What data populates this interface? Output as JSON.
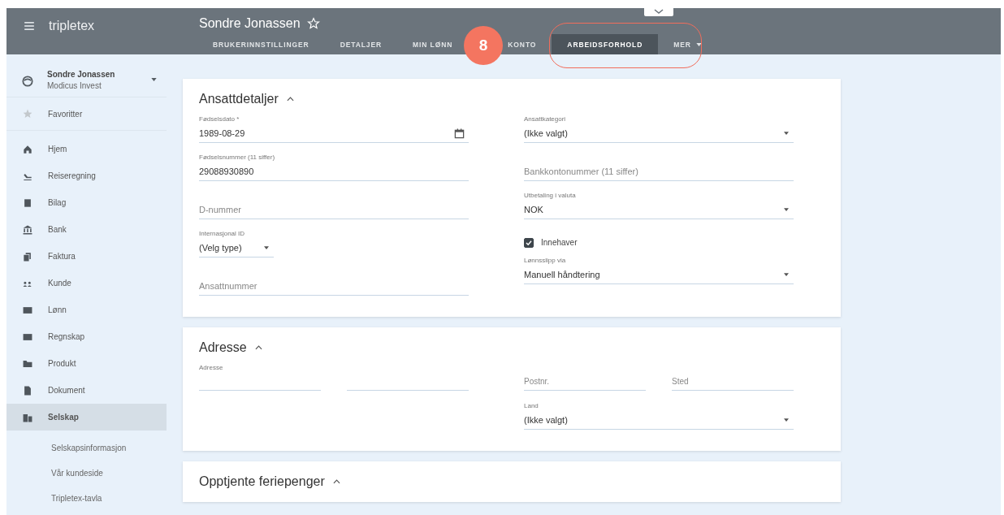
{
  "header": {
    "logo": "tripletex",
    "title": "Sondre Jonassen",
    "favorite": false,
    "tabs": [
      {
        "label": "BRUKERINNSTILLINGER",
        "selected": false
      },
      {
        "label": "DETALJER",
        "selected": false
      },
      {
        "label": "MIN LØNN",
        "selected": false
      },
      {
        "label": "KONTO",
        "selected": false
      },
      {
        "label": "ARBEIDSFORHOLD",
        "selected": true
      },
      {
        "label": "MER",
        "selected": false
      }
    ]
  },
  "callout": {
    "number": "8"
  },
  "sidebar": {
    "user": {
      "name": "Sondre Jonassen",
      "company": "Modicus Invest"
    },
    "favorites": "Favoritter",
    "items": [
      {
        "label": "Hjem",
        "selected": false
      },
      {
        "label": "Reiseregning",
        "selected": false
      },
      {
        "label": "Bilag",
        "selected": false
      },
      {
        "label": "Bank",
        "selected": false
      },
      {
        "label": "Faktura",
        "selected": false
      },
      {
        "label": "Kunde",
        "selected": false
      },
      {
        "label": "Lønn",
        "selected": false
      },
      {
        "label": "Regnskap",
        "selected": false
      },
      {
        "label": "Produkt",
        "selected": false
      },
      {
        "label": "Dokument",
        "selected": false
      },
      {
        "label": "Selskap",
        "selected": true
      }
    ],
    "subitems": [
      "Selskapsinformasjon",
      "Vår kundeside",
      "Tripletex-tavla"
    ]
  },
  "sections": [
    {
      "title": "Ansattdetaljer",
      "expanded": true,
      "left": [
        {
          "kind": "date",
          "label": "Fødselsdato *",
          "value": "1989-08-29"
        },
        {
          "kind": "text",
          "label": "Fødselsnummer (11 siffer)",
          "value": "29088930890"
        },
        {
          "kind": "text",
          "placeholder": "D-nummer"
        },
        {
          "kind": "short-select",
          "label": "Internasjonal ID",
          "value": "(Velg type)"
        },
        {
          "kind": "text",
          "placeholder": "Ansattnummer"
        }
      ],
      "right": [
        {
          "kind": "select",
          "label": "Ansattkategori",
          "value": "(Ikke valgt)"
        },
        {
          "kind": "text",
          "placeholder": "Bankkontonummer (11 siffer)"
        },
        {
          "kind": "select",
          "label": "Utbetaling i valuta",
          "value": "NOK"
        },
        {
          "kind": "checkbox",
          "label": "Innehaver",
          "checked": true
        },
        {
          "kind": "select",
          "label": "Lønnsslipp via",
          "value": "Manuell håndtering"
        }
      ]
    },
    {
      "title": "Adresse",
      "expanded": true,
      "left": [
        {
          "kind": "pair",
          "label": "Adresse"
        }
      ],
      "right": [
        {
          "kind": "pair",
          "placeholders": [
            "Postnr.",
            "Sted"
          ]
        },
        {
          "kind": "select",
          "label": "Land",
          "value": "(Ikke valgt)"
        }
      ]
    },
    {
      "title": "Opptjente feriepenger",
      "expanded": true
    }
  ]
}
